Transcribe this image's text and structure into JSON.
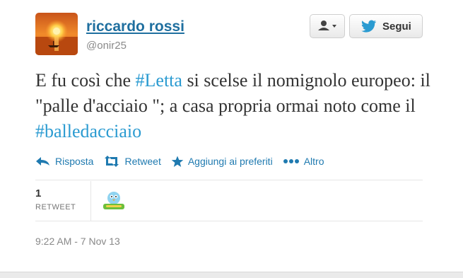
{
  "user": {
    "name": "riccardo rossi",
    "handle": "@onir25"
  },
  "header": {
    "user_menu_icon": "user-dropdown-icon",
    "follow_label": "Segui",
    "follow_icon": "twitter-bird-icon"
  },
  "tweet": {
    "text_1": "E fu così che ",
    "hashtag_1": "#Letta",
    "text_2": " si scelse il nomignolo europeo: il \"palle d'acciaio \"; a casa propria ormai noto come il ",
    "hashtag_2": "#balledacciaio"
  },
  "actions": {
    "reply": "Risposta",
    "retweet": "Retweet",
    "favorite": "Aggiungi ai preferiti",
    "more": "Altro"
  },
  "stats": {
    "retweet_count": "1",
    "retweet_label": "RETWEET"
  },
  "timestamp": "9:22 AM - 7 Nov 13",
  "colors": {
    "link": "#1f7ab0",
    "hashtag": "#2b9bd1",
    "name": "#1f6f9f"
  }
}
